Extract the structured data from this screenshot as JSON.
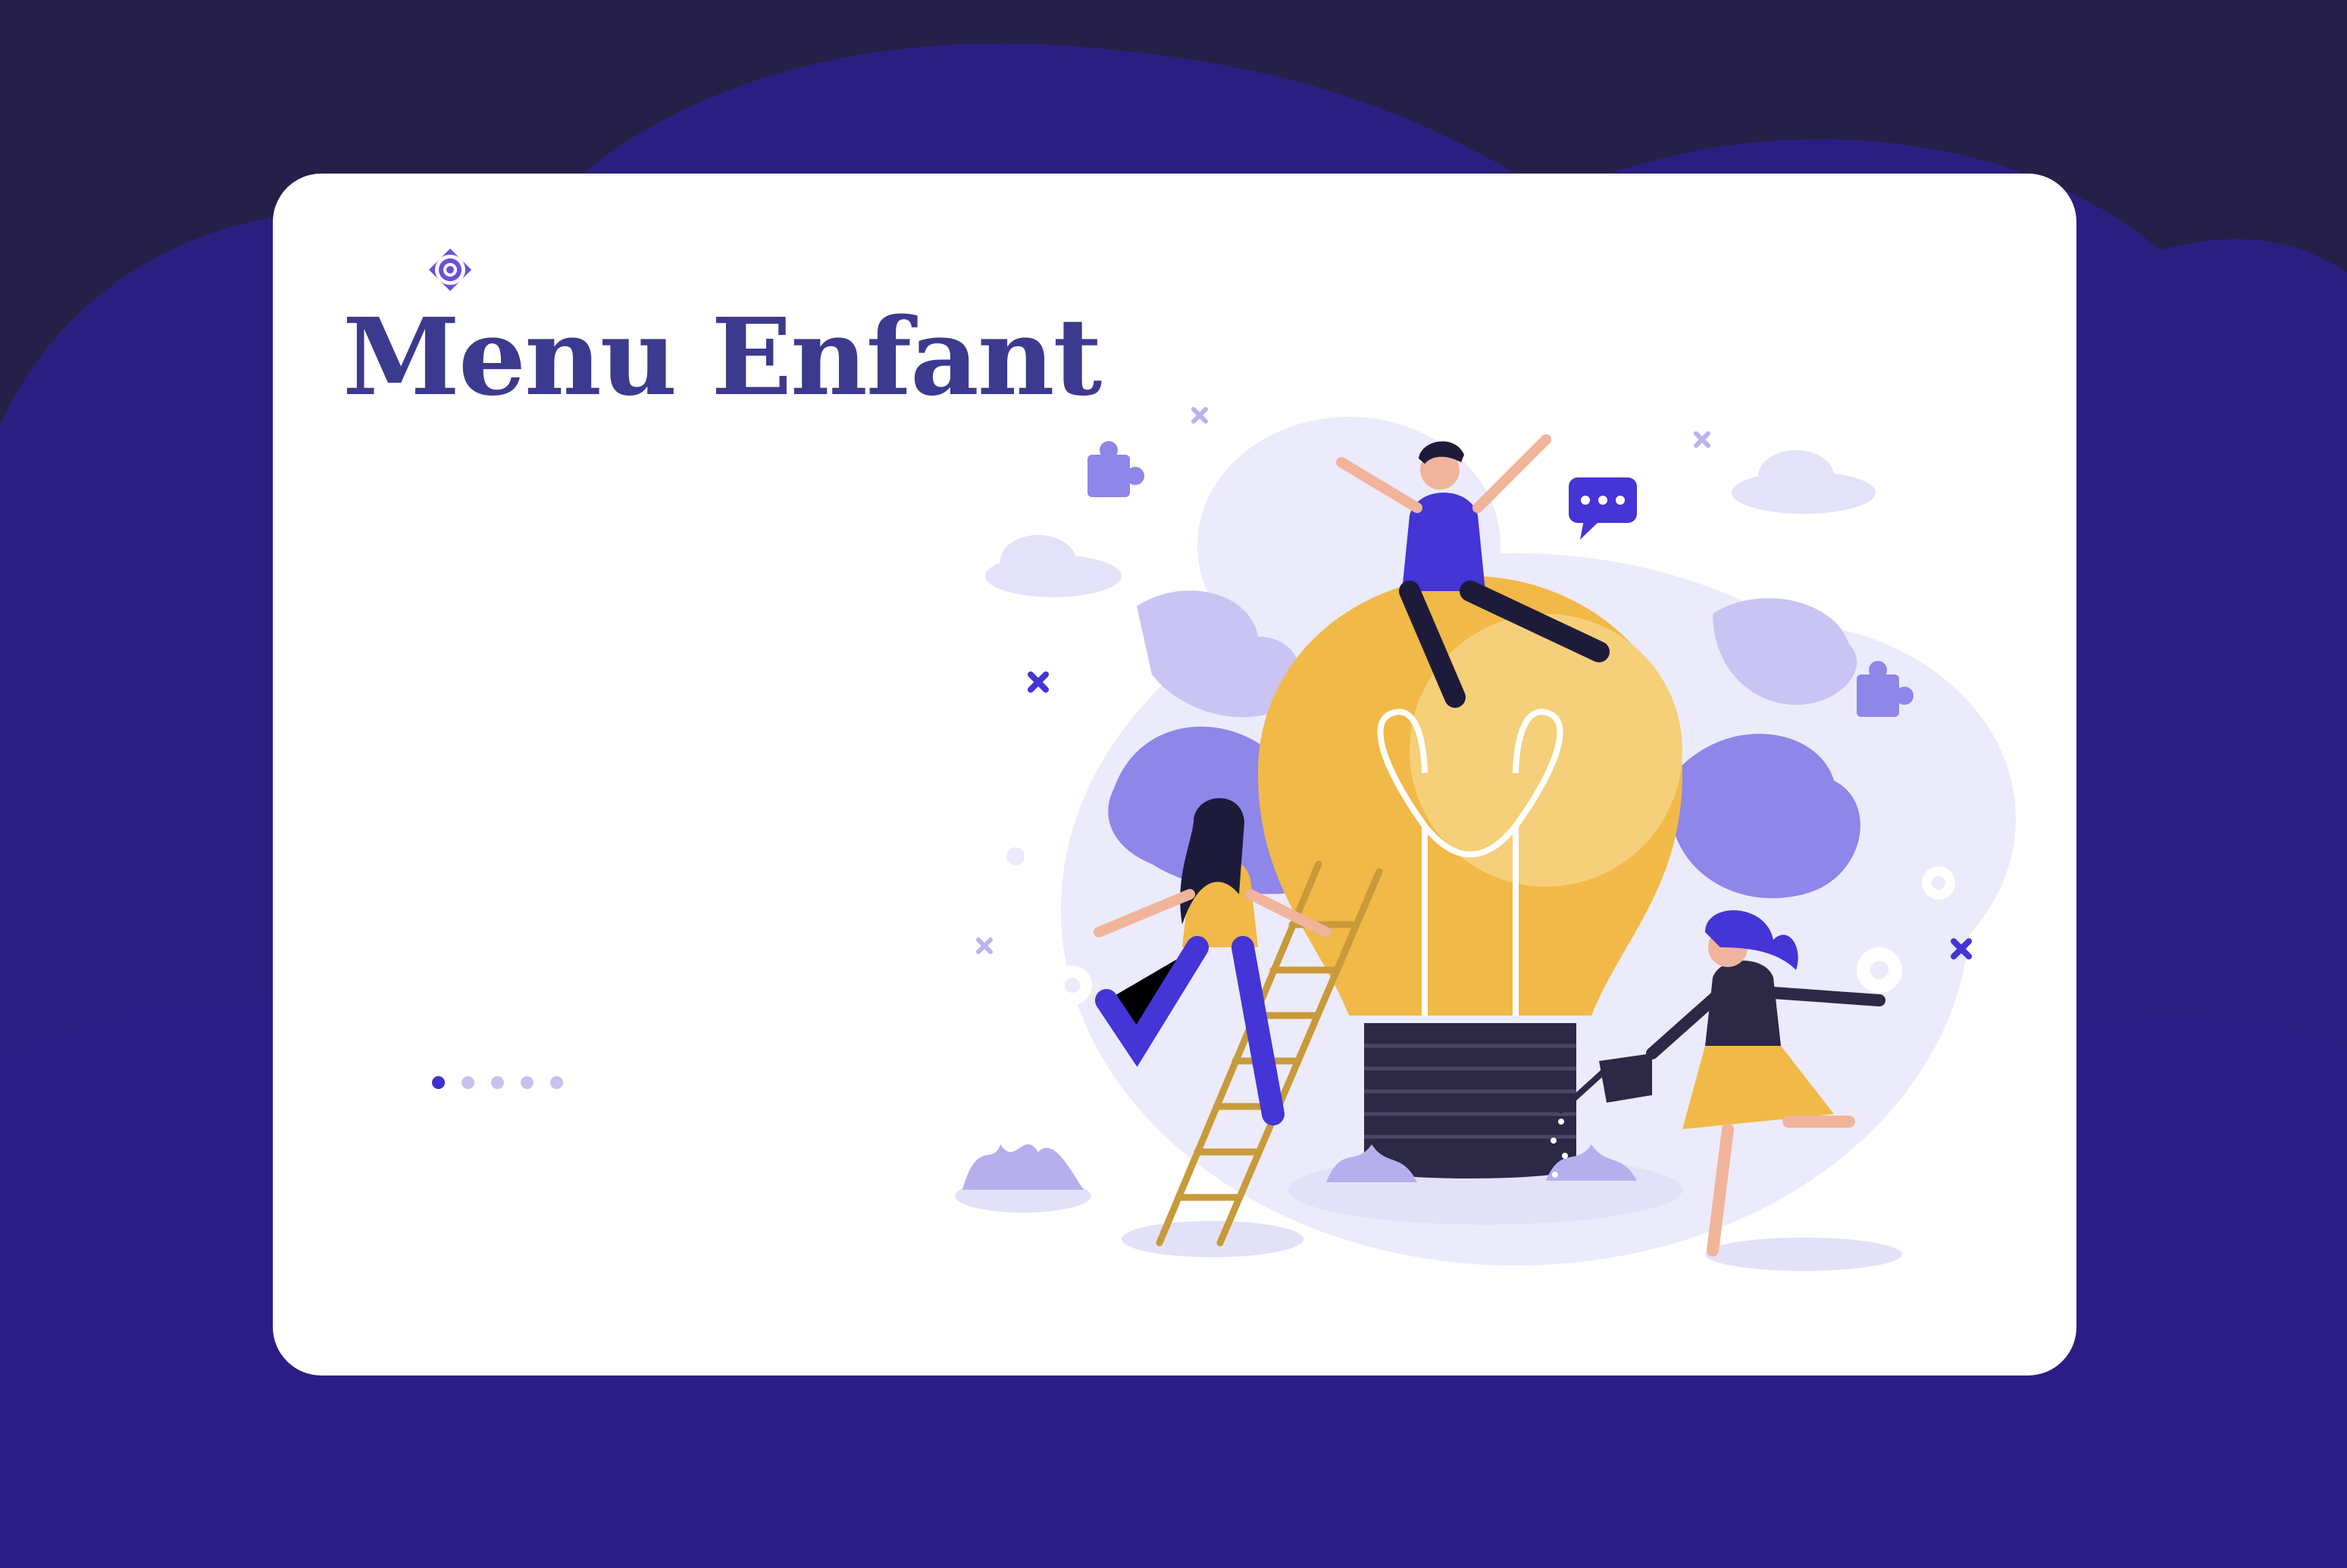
{
  "page": {
    "title": "Menu Enfant"
  },
  "carousel": {
    "slide_count": 5,
    "active_index": 0
  },
  "colors": {
    "background_dark": "#262048",
    "background_blob": "#2c1f86",
    "card": "#ffffff",
    "title": "#3b3a8e",
    "accent": "#4534d6",
    "dot_active": "#3d2fd0",
    "dot_inactive": "#c5c2f0",
    "bulb": "#f1b947",
    "lavender": "#8e86e8"
  },
  "icons": {
    "logo": "target-logo-icon",
    "illustration": "lightbulb-teamwork-illustration"
  }
}
